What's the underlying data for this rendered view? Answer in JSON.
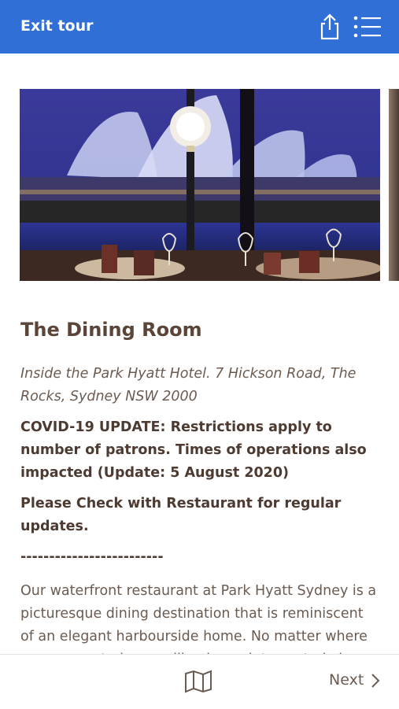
{
  "header": {
    "exit_label": "Exit tour",
    "share_icon": "share-icon",
    "menu_icon": "list-menu-icon",
    "bg_color": "#2f6fd6"
  },
  "gallery": {
    "photo": "Sydney Opera House at night seen through restaurant window with dining tables"
  },
  "place": {
    "title": "The Dining Room",
    "address": "Inside the Park Hyatt Hotel. 7 Hickson Road, The Rocks, Sydney NSW 2000",
    "covid_update": "COVID-19 UPDATE: Restrictions apply to number of patrons. Times of operations also impacted (Update: 5 August 2020)",
    "check_note": "Please Check with Restaurant for regular updates.",
    "divider": "-------------------------",
    "description": "Our waterfront restaurant at Park Hyatt Sydney is a picturesque dining destination that is reminiscent of an elegant harbourside home. No matter where you are seated, you will enjoy uninterrupted views of the"
  },
  "footer": {
    "map_icon": "map-icon",
    "next_label": "Next",
    "next_icon": "chevron-right-icon"
  }
}
